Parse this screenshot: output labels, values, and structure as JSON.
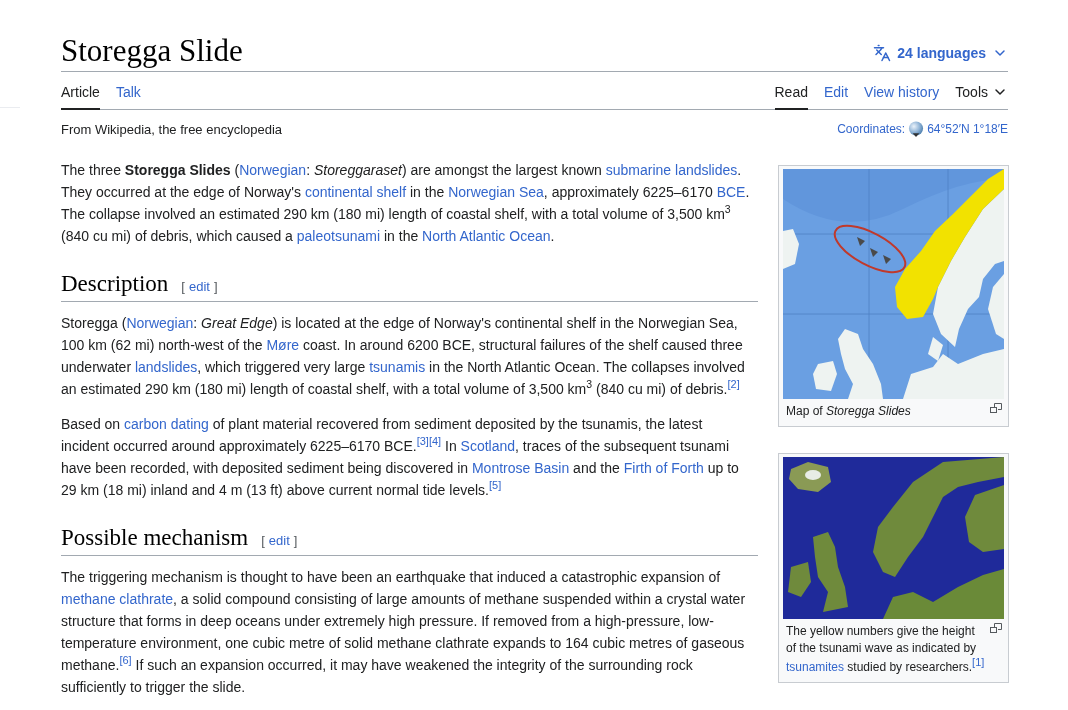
{
  "page": {
    "title": "Storegga Slide",
    "language_button": "24 languages"
  },
  "namespace_tabs": [
    {
      "kind": "tab",
      "label": "Article",
      "selected": true
    },
    {
      "kind": "tab",
      "label": "Talk",
      "selected": false
    }
  ],
  "view_tabs": [
    {
      "kind": "tab",
      "label": "Read",
      "selected": true
    },
    {
      "kind": "tab",
      "label": "Edit",
      "selected": false
    },
    {
      "kind": "tab",
      "label": "View history",
      "selected": false
    },
    {
      "kind": "menu",
      "label": "Tools",
      "selected": false
    }
  ],
  "tagline": "From Wikipedia, the free encyclopedia",
  "coordinates": {
    "label": "Coordinates:",
    "value": "64°52′N 1°18′E"
  },
  "sections": [
    {
      "paragraphs": [
        [
          {
            "kind": "text",
            "text": "The three **Storegga Slides** ("
          },
          {
            "kind": "link",
            "text": "Norwegian"
          },
          {
            "kind": "text",
            "text": ": *Storeggaraset*) are amongst the largest known "
          },
          {
            "kind": "link",
            "text": "submarine landslides"
          },
          {
            "kind": "text",
            "text": ". They occurred at the edge of Norway's "
          },
          {
            "kind": "link",
            "text": "continental shelf"
          },
          {
            "kind": "text",
            "text": " in the "
          },
          {
            "kind": "link",
            "text": "Norwegian Sea"
          },
          {
            "kind": "text",
            "text": ", approximately 6225–6170 "
          },
          {
            "kind": "link",
            "text": "BCE"
          },
          {
            "kind": "text",
            "text": ". The collapse involved an estimated 290 km (180 mi) length of coastal shelf, with a total volume of 3,500 km$^{3}$ (840 cu mi) of debris, which caused a "
          },
          {
            "kind": "link",
            "text": "paleotsunami"
          },
          {
            "kind": "text",
            "text": " in the "
          },
          {
            "kind": "link",
            "text": "North Atlantic Ocean"
          },
          {
            "kind": "text",
            "text": "."
          }
        ]
      ]
    },
    {
      "heading": {
        "title": "Description",
        "edit": {
          "open": "[",
          "label": "edit",
          "close": "]"
        }
      },
      "paragraphs": [
        [
          {
            "kind": "text",
            "text": "Storegga ("
          },
          {
            "kind": "link",
            "text": "Norwegian"
          },
          {
            "kind": "text",
            "text": ": *Great Edge*) is located at the edge of Norway's continental shelf in the Norwegian Sea, 100 km (62 mi) north-west of the "
          },
          {
            "kind": "link",
            "text": "Møre"
          },
          {
            "kind": "text",
            "text": " coast. In around 6200 BCE, structural failures of the shelf caused three underwater "
          },
          {
            "kind": "link",
            "text": "landslides"
          },
          {
            "kind": "text",
            "text": ", which triggered very large "
          },
          {
            "kind": "link",
            "text": "tsunamis"
          },
          {
            "kind": "text",
            "text": " in the North Atlantic Ocean. The collapses involved an estimated 290 km (180 mi) length of coastal shelf, with a total volume of 3,500 km$^{3}$ (840 cu mi) of debris."
          },
          {
            "kind": "ref",
            "text": "[2]"
          }
        ],
        [
          {
            "kind": "text",
            "text": "Based on "
          },
          {
            "kind": "link",
            "text": "carbon dating"
          },
          {
            "kind": "text",
            "text": " of plant material recovered from sediment deposited by the tsunamis, the latest incident occurred around approximately 6225–6170 BCE."
          },
          {
            "kind": "ref",
            "text": "[3]"
          },
          {
            "kind": "ref",
            "text": "[4]"
          },
          {
            "kind": "text",
            "text": " In "
          },
          {
            "kind": "link",
            "text": "Scotland"
          },
          {
            "kind": "text",
            "text": ", traces of the subsequent tsunami have been recorded, with deposited sediment being discovered in "
          },
          {
            "kind": "link",
            "text": "Montrose Basin"
          },
          {
            "kind": "text",
            "text": " and the "
          },
          {
            "kind": "link",
            "text": "Firth of Forth"
          },
          {
            "kind": "text",
            "text": " up to 29 km (18 mi) inland and 4 m (13 ft) above current normal tide levels."
          },
          {
            "kind": "ref",
            "text": "[5]"
          }
        ]
      ]
    },
    {
      "heading": {
        "title": "Possible mechanism",
        "edit": {
          "open": "[",
          "label": "edit",
          "close": "]"
        }
      },
      "paragraphs": [
        [
          {
            "kind": "text",
            "text": "The triggering mechanism is thought to have been an earthquake that induced a catastrophic expansion of "
          },
          {
            "kind": "link",
            "text": "methane clathrate"
          },
          {
            "kind": "text",
            "text": ", a solid compound consisting of large amounts of methane suspended within a crystal water structure that forms in deep oceans under extremely high pressure. If removed from a high-pressure, low-temperature environment, one cubic metre of solid methane clathrate expands to 164 cubic metres of gaseous methane."
          },
          {
            "kind": "ref",
            "text": "[6]"
          },
          {
            "kind": "text",
            "text": " If such an expansion occurred, it may have weakened the integrity of the surrounding rock sufficiently to trigger the slide."
          }
        ]
      ]
    }
  ],
  "figures": [
    {
      "kind": "locator_map",
      "caption": [
        {
          "kind": "text",
          "text": "Map of *Storegga Slides*"
        }
      ]
    },
    {
      "kind": "satellite_map",
      "caption": [
        {
          "kind": "text",
          "text": "The yellow numbers give the height of the tsunami wave as indicated by "
        },
        {
          "kind": "link",
          "text": "tsunamites"
        },
        {
          "kind": "text",
          "text": " studied by researchers."
        },
        {
          "kind": "ref",
          "text": "[1]"
        }
      ]
    }
  ]
}
